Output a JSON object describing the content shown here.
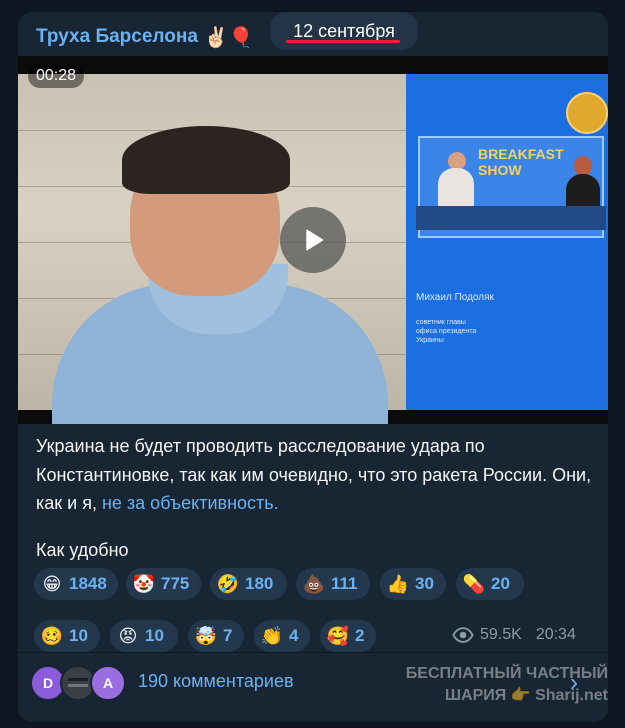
{
  "header": {
    "channel_name": "Труха Барселона",
    "channel_emoji": "✌🏻🎈",
    "date": "12 сентября"
  },
  "video": {
    "duration": "00:28",
    "caption_name": "Михаил Подоляк",
    "caption_role": "советник главы офиса президента Украины",
    "show_logo": "BREAKFAST SHOW"
  },
  "message": {
    "text_before_link": "Украина не будет проводить расследование удара по Константиновке, так как им очевидно, что это ракета России. Они, как и я, ",
    "link_text": "не за объективность.",
    "second_line": "Как удобно"
  },
  "reactions": [
    {
      "emoji": "😁",
      "count": "1848"
    },
    {
      "emoji": "🤡",
      "count": "775"
    },
    {
      "emoji": "🤣",
      "count": "180"
    },
    {
      "emoji": "💩",
      "count": "111"
    },
    {
      "emoji": "👍",
      "count": "30"
    },
    {
      "emoji": "💊",
      "count": "20"
    },
    {
      "emoji": "🥴",
      "count": "10"
    },
    {
      "emoji": "😡",
      "count": "10"
    },
    {
      "emoji": "🤯",
      "count": "7"
    },
    {
      "emoji": "👏",
      "count": "4"
    },
    {
      "emoji": "🥰",
      "count": "2"
    }
  ],
  "meta": {
    "views": "59.5K",
    "time": "20:34"
  },
  "footer": {
    "avatar_1": "D",
    "avatar_3": "A",
    "comments": "190 комментариев",
    "watermark_line1": "БЕСПЛАТНЫЙ ЧАСТНЫЙ",
    "watermark_line2": "ШАРИЯ 👉 Sharij.net"
  },
  "colors": {
    "background": "#0e1621",
    "card": "#182533",
    "accent": "#6ab2f2",
    "reaction_bg": "#23384d",
    "underline_red": "#e8203a"
  }
}
